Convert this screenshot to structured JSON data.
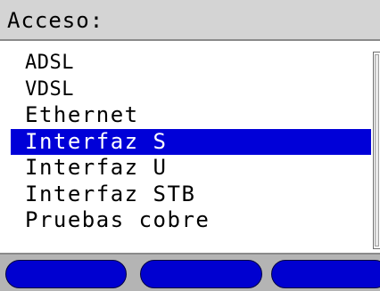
{
  "window": {
    "title": "Acceso:"
  },
  "menu": {
    "items": [
      {
        "label": "ADSL"
      },
      {
        "label": "VDSL"
      },
      {
        "label": "Ethernet"
      },
      {
        "label": "Interfaz S"
      },
      {
        "label": "Interfaz U"
      },
      {
        "label": "Interfaz STB"
      },
      {
        "label": "Pruebas cobre"
      }
    ],
    "selected_index": 3
  },
  "softkeys": [
    {
      "label": ""
    },
    {
      "label": ""
    },
    {
      "label": ""
    }
  ],
  "colors": {
    "selection": "#0000d8",
    "softkey": "#0000d0",
    "titlebar": "#d4d4d4"
  }
}
